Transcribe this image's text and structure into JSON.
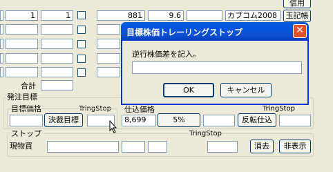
{
  "top_row": {
    "cells": [
      "1",
      "1",
      "",
      "881",
      "9.6",
      ""
    ],
    "company": "カプコム2008",
    "ledger_button": "玉記帳",
    "credit_button": "信用"
  },
  "total_label": "合計",
  "order_target": {
    "legend": "発注目標",
    "target_price_label": "目標価格",
    "tringstop_label1": "TringStop",
    "order_price_label": "仕込価格",
    "tringstop_label2": "TringStop",
    "settle_button": "決裁目標",
    "order_price_value": "8,699",
    "percent_value": "5%",
    "reverse_button": "反転仕込"
  },
  "stop": {
    "legend": "ストップ",
    "tringstop_label": "TringStop",
    "physical_label": "現物買",
    "clear_button": "消去",
    "hide_button": "非表示"
  },
  "dialog": {
    "title": "目標株価トレーリングストップ",
    "prompt": "逆行株価差を記入。",
    "input_value": "",
    "ok_label": "OK",
    "cancel_label": "キャンセル"
  }
}
